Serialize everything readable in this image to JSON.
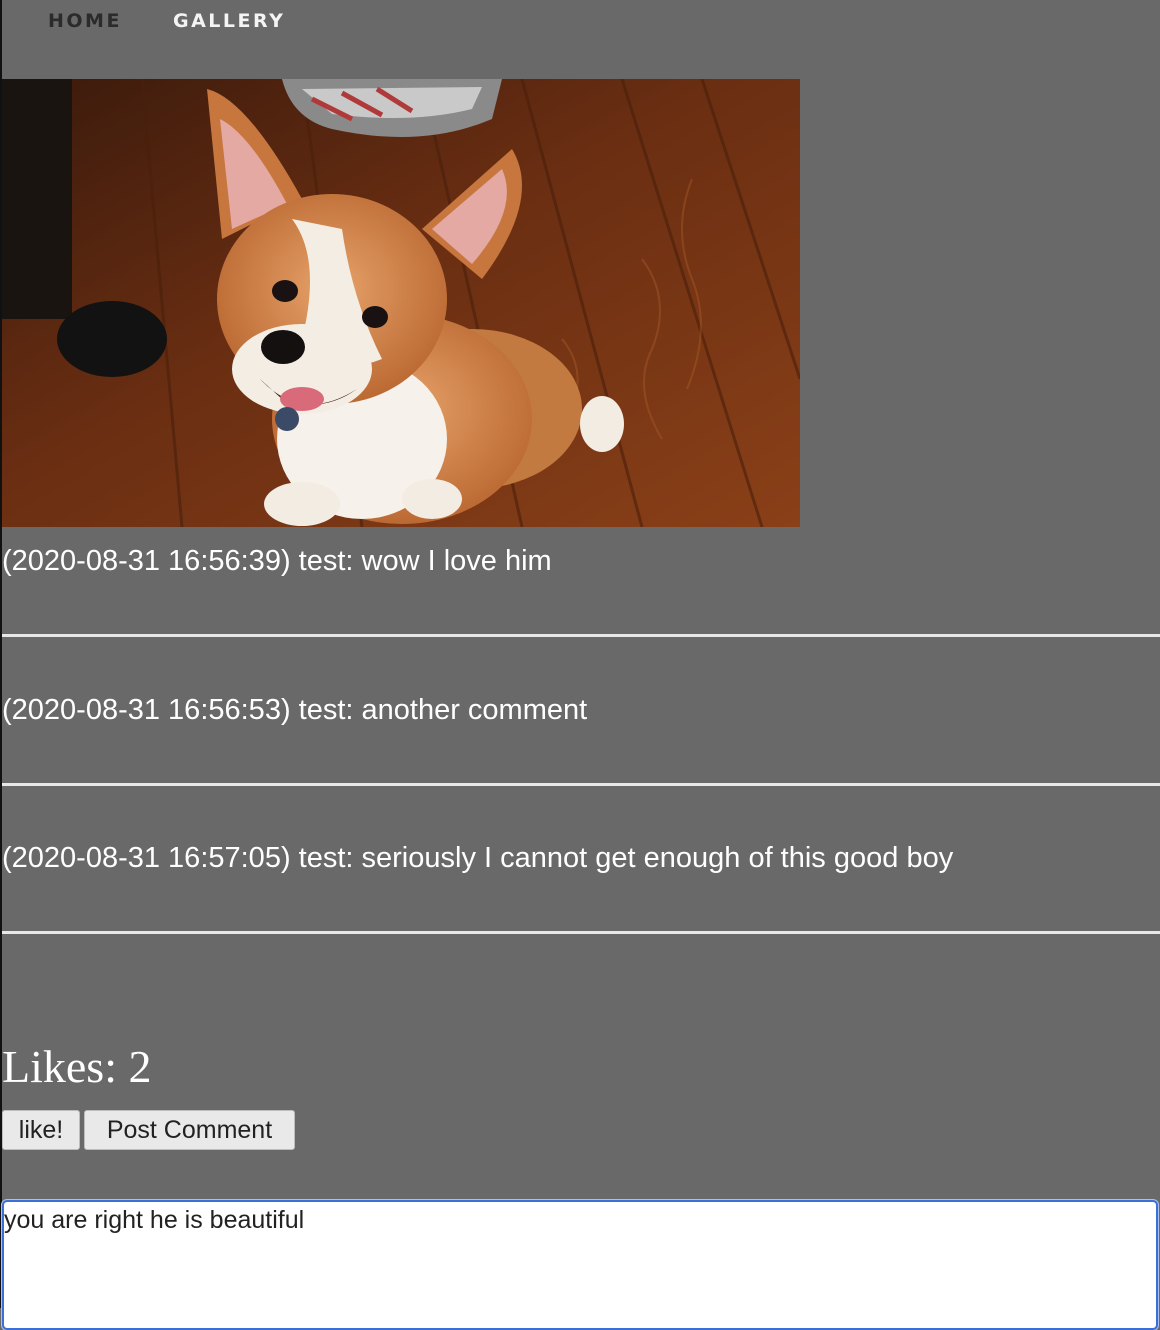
{
  "nav": {
    "home_label": "HOME",
    "gallery_label": "GALLERY"
  },
  "comments": [
    {
      "text": "(2020-08-31 16:56:39) test: wow I love him"
    },
    {
      "text": "(2020-08-31 16:56:53) test: another comment"
    },
    {
      "text": "(2020-08-31 16:57:05) test: seriously I cannot get enough of this good boy"
    }
  ],
  "likes": {
    "text": "Likes: 2"
  },
  "actions": {
    "like_label": "like!",
    "post_comment_label": "Post Comment"
  },
  "comment_input": {
    "value": "you are right he is beautiful"
  },
  "colors": {
    "page_background": "#696969",
    "input_focus_border": "#3a6fd8"
  }
}
